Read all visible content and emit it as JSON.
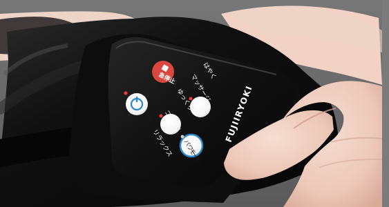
{
  "photo": {
    "buttons": {
      "emergency_stop": "急停止",
      "power": "",
      "relax": "リラックス",
      "course": "コースリ",
      "slow_soft": "ゆっくり",
      "massage": "マッサージ",
      "fast": "はやく",
      "power_mode": "パワー",
      "mode": "モード"
    },
    "brand": "FUJIIRYOKI",
    "colors": {
      "device_black": "#121212",
      "panel_black": "#080808",
      "stop_red": "#d9473f",
      "power_blue": "#2d8ac7",
      "skin": "#f0d2c5"
    }
  }
}
